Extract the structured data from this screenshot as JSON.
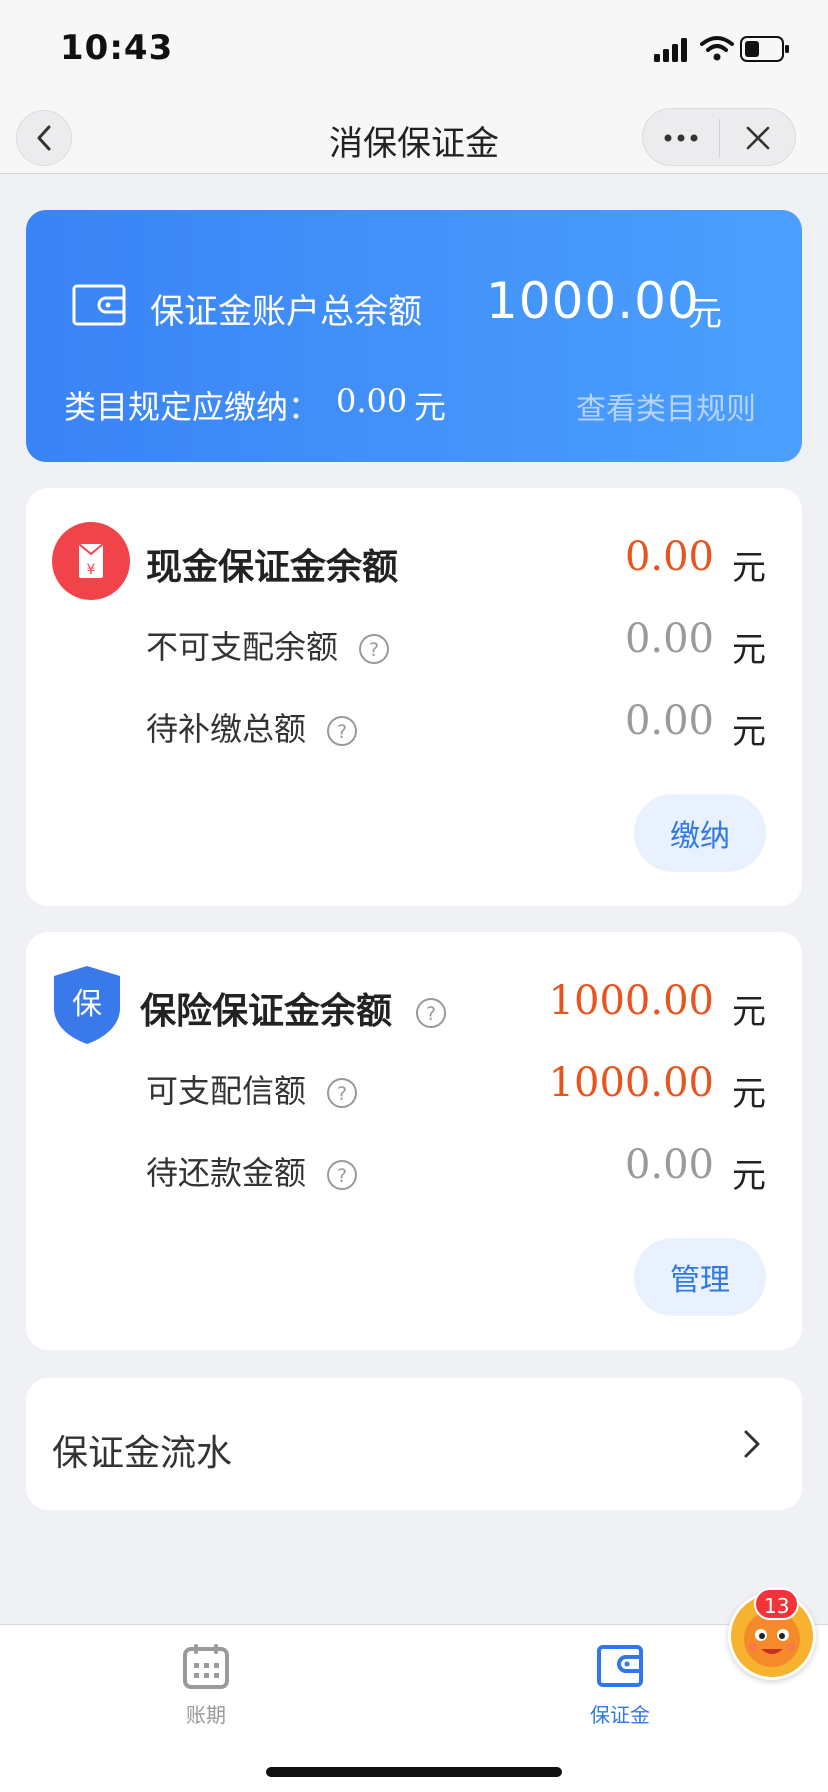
{
  "status_bar": {
    "time": "10:43"
  },
  "nav": {
    "title": "消保保证金"
  },
  "summary": {
    "total_label": "保证金账户总余额",
    "total_amount": "1000.00",
    "total_unit": "元",
    "rule_label": "类目规定应缴纳：",
    "rule_amount": "0.00",
    "rule_unit": "元",
    "view_rules": "查看类目规则"
  },
  "cash": {
    "title": "现金保证金余额",
    "amount": "0.00",
    "unit": "元",
    "rows": [
      {
        "label": "不可支配余额",
        "amount": "0.00",
        "unit": "元"
      },
      {
        "label": "待补缴总额",
        "amount": "0.00",
        "unit": "元"
      }
    ],
    "button": "缴纳"
  },
  "insurance": {
    "icon_text": "保",
    "title": "保险保证金余额",
    "amount": "1000.00",
    "unit": "元",
    "rows": [
      {
        "label": "可支配信额",
        "amount": "1000.00",
        "unit": "元"
      },
      {
        "label": "待还款金额",
        "amount": "0.00",
        "unit": "元"
      }
    ],
    "button": "管理"
  },
  "flow": {
    "label": "保证金流水"
  },
  "tabs": [
    {
      "label": "账期",
      "icon": "calendar-icon",
      "active": false
    },
    {
      "label": "保证金",
      "icon": "wallet-icon",
      "active": true
    }
  ],
  "badge": {
    "count": "13"
  },
  "colors": {
    "accent": "#2f78e6",
    "amount_red": "#e8541d",
    "card_blue": "#3a83f6"
  }
}
